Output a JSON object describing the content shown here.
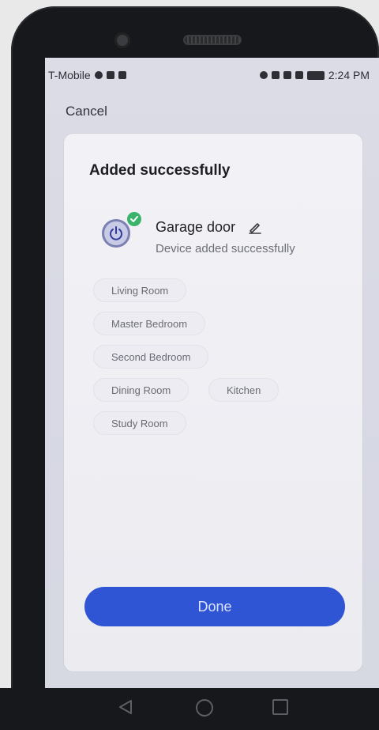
{
  "status_bar": {
    "carrier": "T-Mobile",
    "time": "2:24 PM"
  },
  "header": {
    "cancel_label": "Cancel"
  },
  "dialog": {
    "title": "Added successfully",
    "device": {
      "name": "Garage door",
      "status": "Device added successfully"
    },
    "rooms": [
      {
        "label": "Living Room"
      },
      {
        "label": "Master Bedroom"
      },
      {
        "label": "Second Bedroom"
      },
      {
        "label": "Dining Room"
      },
      {
        "label": "Kitchen"
      },
      {
        "label": "Study Room"
      }
    ],
    "done_label": "Done"
  },
  "colors": {
    "primary_button": "#2f55d4",
    "success_badge": "#3bb36a"
  },
  "icons": {
    "device": "power-icon",
    "badge": "check-icon",
    "edit": "pencil-icon",
    "nav": [
      "back-icon",
      "home-icon",
      "recent-apps-icon"
    ]
  }
}
